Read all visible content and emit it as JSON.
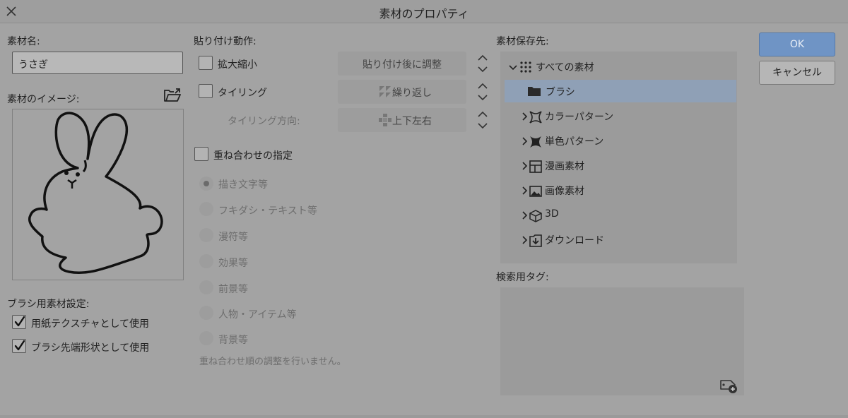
{
  "dialog": {
    "title": "素材のプロパティ"
  },
  "material_name": {
    "label": "素材名:",
    "value": "うさぎ"
  },
  "material_image": {
    "label": "素材のイメージ:"
  },
  "brush_settings": {
    "label": "ブラシ用素材設定:",
    "paper_texture": {
      "label": "用紙テクスチャとして使用",
      "checked": true
    },
    "brush_tip": {
      "label": "ブラシ先端形状として使用",
      "checked": true
    }
  },
  "paste": {
    "label": "貼り付け動作:",
    "scale": {
      "label": "拡大縮小",
      "checked": false,
      "value": "貼り付け後に調整"
    },
    "tiling": {
      "label": "タイリング",
      "checked": false,
      "value": "繰り返し"
    },
    "tiling_direction": {
      "label": "タイリング方向:",
      "value": "上下左右"
    }
  },
  "overlay": {
    "label": "重ね合わせの指定",
    "checked": false,
    "options": [
      {
        "label": "描き文字等",
        "selected": true
      },
      {
        "label": "フキダシ・テキスト等",
        "selected": false
      },
      {
        "label": "漫符等",
        "selected": false
      },
      {
        "label": "効果等",
        "selected": false
      },
      {
        "label": "前景等",
        "selected": false
      },
      {
        "label": "人物・アイテム等",
        "selected": false
      },
      {
        "label": "背景等",
        "selected": false
      }
    ],
    "note": "重ね合わせ順の調整を行いません。"
  },
  "save_location": {
    "label": "素材保存先:",
    "tree": [
      {
        "label": "すべての素材",
        "icon": "grid-dots-icon"
      },
      {
        "label": "ブラシ",
        "icon": "folder-icon",
        "selected": true
      },
      {
        "label": "カラーパターン",
        "icon": "color-pattern-icon"
      },
      {
        "label": "単色パターン",
        "icon": "mono-pattern-icon"
      },
      {
        "label": "漫画素材",
        "icon": "manga-frame-icon"
      },
      {
        "label": "画像素材",
        "icon": "image-icon"
      },
      {
        "label": "3D",
        "icon": "cube-icon"
      },
      {
        "label": "ダウンロード",
        "icon": "download-icon"
      }
    ]
  },
  "search_tags": {
    "label": "検索用タグ:"
  },
  "buttons": {
    "ok": "OK",
    "cancel": "キャンセル"
  },
  "colors": {
    "ok_button": "#6f94c5",
    "selection": "#8fa0b6",
    "background": "#a3a3a3"
  }
}
